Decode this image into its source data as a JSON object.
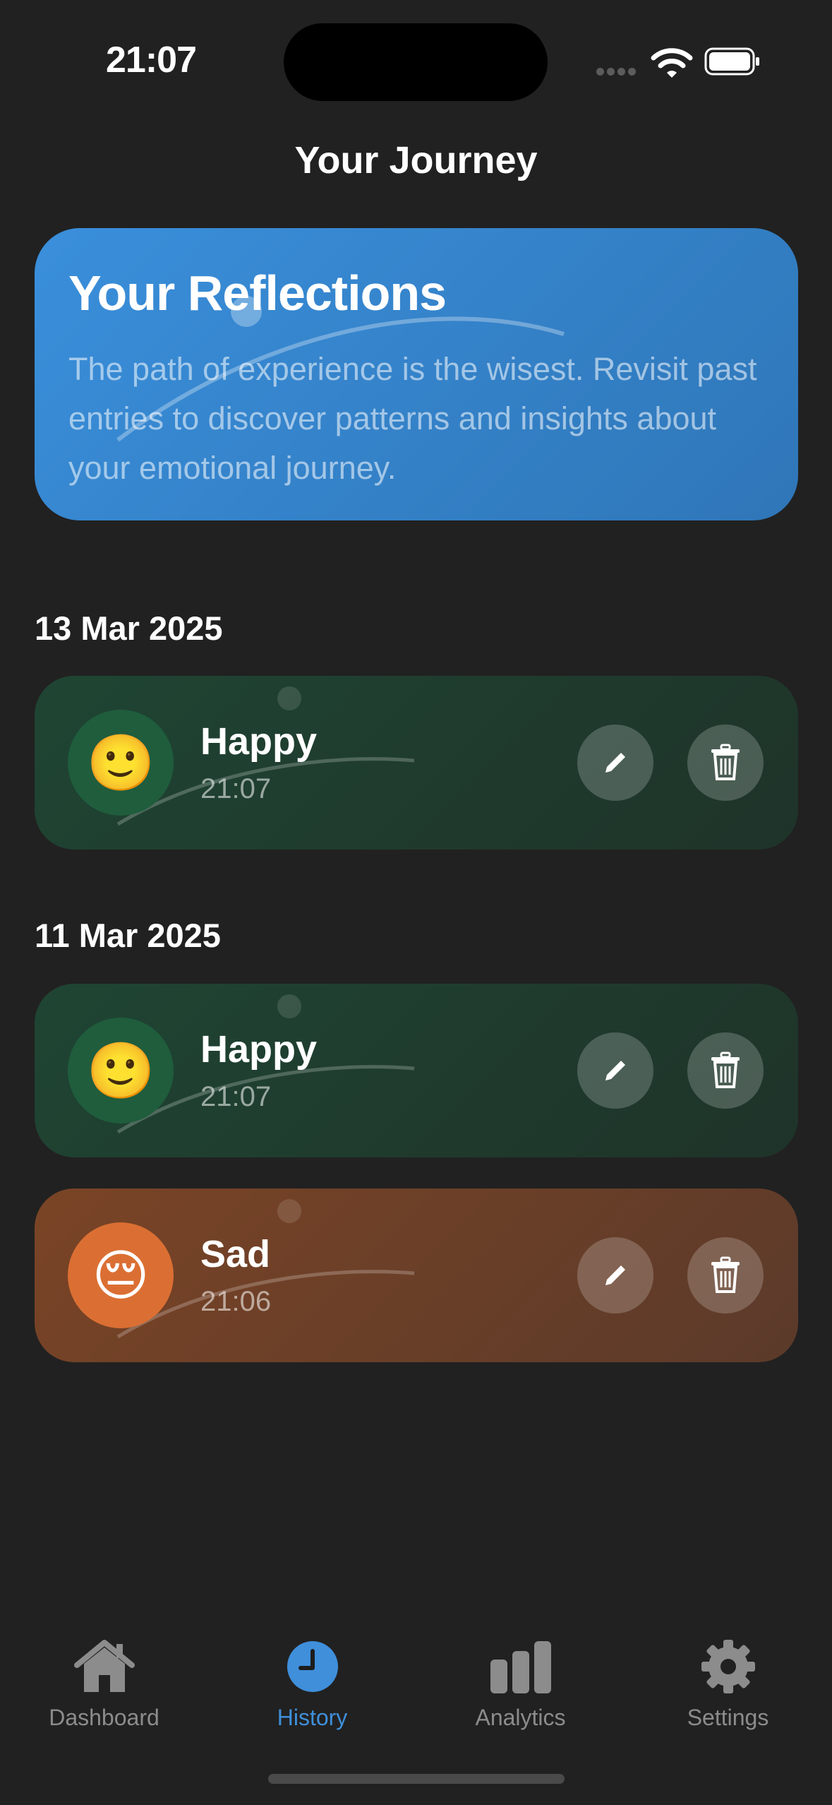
{
  "status_bar": {
    "time": "21:07"
  },
  "header": {
    "title": "Your Journey"
  },
  "hero": {
    "title": "Your Reflections",
    "text": "The path of experience is the wisest. Revisit past entries to discover patterns and insights about your emotional journey."
  },
  "groups": [
    {
      "date": "13 Mar 2025",
      "entries": [
        {
          "emoji": "🙂",
          "mood": "Happy",
          "time": "21:07",
          "color": "#1f5d3d"
        }
      ]
    },
    {
      "date": "11 Mar 2025",
      "entries": [
        {
          "emoji": "🙂",
          "mood": "Happy",
          "time": "21:07",
          "color": "#1f5d3d"
        },
        {
          "emoji": "😔",
          "mood": "Sad",
          "time": "21:06",
          "color": "#db6f33"
        }
      ]
    }
  ],
  "tabs": [
    {
      "label": "Dashboard",
      "icon": "house-icon",
      "active": false
    },
    {
      "label": "History",
      "icon": "clock-icon",
      "active": true
    },
    {
      "label": "Analytics",
      "icon": "bar-chart-icon",
      "active": false
    },
    {
      "label": "Settings",
      "icon": "gear-icon",
      "active": false
    }
  ],
  "colors": {
    "accent": "#3f8fdb",
    "background": "#212121",
    "happy": "#1f5d3d",
    "sad": "#db6f33"
  }
}
